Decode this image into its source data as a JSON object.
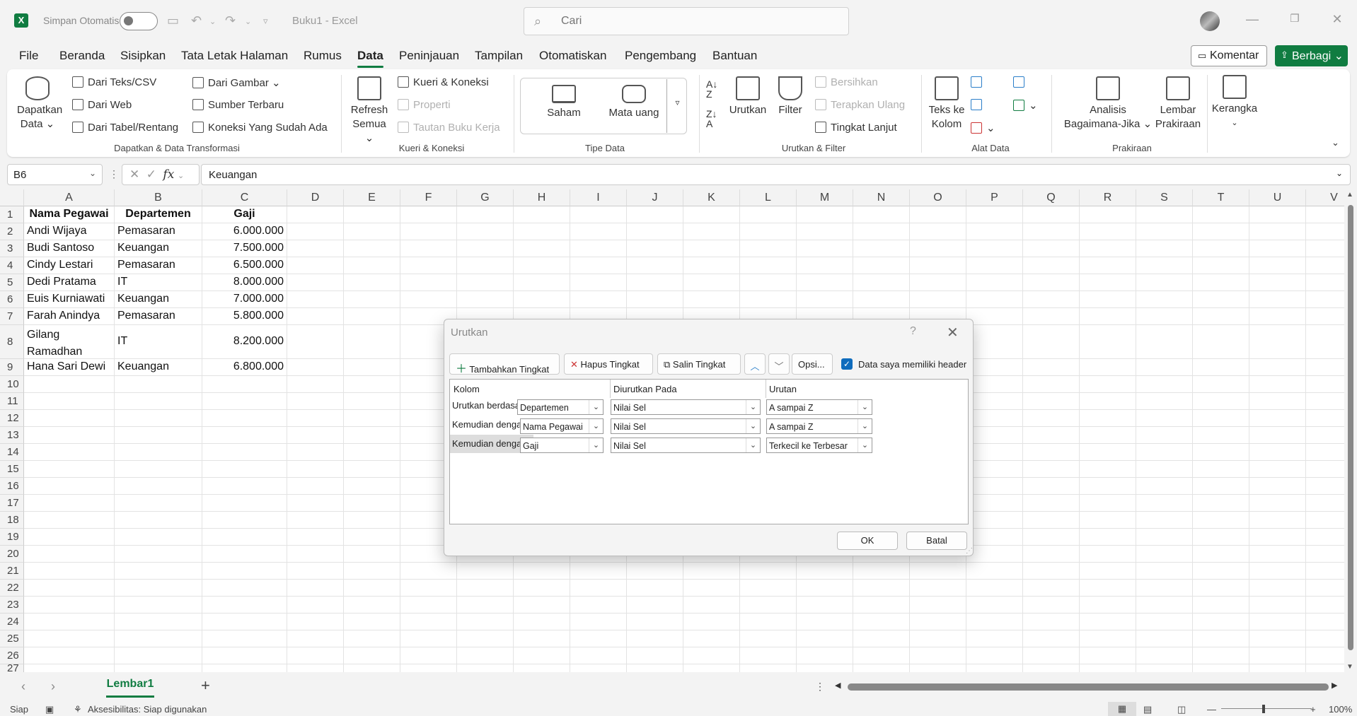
{
  "titlebar": {
    "logo": "X",
    "autosave": "Simpan Otomatis",
    "doc_title": "Buku1  -  Excel",
    "search_placeholder": "Cari"
  },
  "menu": [
    "File",
    "Beranda",
    "Sisipkan",
    "Tata Letak Halaman",
    "Rumus",
    "Data",
    "Peninjauan",
    "Tampilan",
    "Otomatiskan",
    "Pengembang",
    "Bantuan"
  ],
  "actions": {
    "komentar": "Komentar",
    "berbagi": "Berbagi"
  },
  "ribbon": {
    "dapatkan_data": [
      "Dapatkan",
      "Data ⌄"
    ],
    "dari_teks_csv": "Dari Teks/CSV",
    "dari_web": "Dari Web",
    "dari_tabel": "Dari Tabel/Rentang",
    "dari_gambar": "Dari Gambar ⌄",
    "sumber_terbaru": "Sumber Terbaru",
    "koneksi_ada": "Koneksi Yang Sudah Ada",
    "group1": "Dapatkan & Data Transformasi",
    "refresh": [
      "Refresh",
      "Semua ⌄"
    ],
    "kueri_koneksi": "Kueri & Koneksi",
    "properti": "Properti",
    "tautan": "Tautan Buku Kerja",
    "group2": "Kueri & Koneksi",
    "saham": "Saham",
    "mata_uang": "Mata uang",
    "group3": "Tipe Data",
    "urutkan": "Urutkan",
    "filter": "Filter",
    "bersihkan": "Bersihkan",
    "terapkan_ulang": "Terapkan Ulang",
    "tingkat_lanjut": "Tingkat Lanjut",
    "group4": "Urutkan & Filter",
    "teks_ke_kolom": [
      "Teks ke",
      "Kolom"
    ],
    "group5": "Alat Data",
    "analisis": [
      "Analisis",
      "Bagaimana-Jika ⌄"
    ],
    "lembar_prakiraan": [
      "Lembar",
      "Prakiraan"
    ],
    "group6": "Prakiraan",
    "kerangka": "Kerangka"
  },
  "formula_bar": {
    "name_box": "B6",
    "formula": "Keuangan"
  },
  "columns": [
    "A",
    "B",
    "C",
    "D",
    "E",
    "F",
    "G",
    "H",
    "I",
    "J",
    "K",
    "L",
    "M",
    "N",
    "O",
    "P",
    "Q",
    "R",
    "S",
    "T",
    "U",
    "V"
  ],
  "rows": [
    "1",
    "2",
    "3",
    "4",
    "5",
    "6",
    "7",
    "8",
    "9",
    "10",
    "11",
    "12",
    "13",
    "14",
    "15",
    "16",
    "17",
    "18",
    "19",
    "20",
    "21",
    "22",
    "23",
    "24",
    "25",
    "26",
    "27"
  ],
  "sheet": {
    "headers": [
      "Nama Pegawai",
      "Departemen",
      "Gaji"
    ],
    "data": [
      [
        "Andi Wijaya",
        "Pemasaran",
        "6.000.000"
      ],
      [
        "Budi Santoso",
        "Keuangan",
        "7.500.000"
      ],
      [
        "Cindy Lestari",
        "Pemasaran",
        "6.500.000"
      ],
      [
        "Dedi Pratama",
        "IT",
        "8.000.000"
      ],
      [
        "Euis Kurniawati",
        "Keuangan",
        "7.000.000"
      ],
      [
        "Farah Anindya",
        "Pemasaran",
        "5.800.000"
      ],
      [
        "Gilang Ramadhan",
        "IT",
        "8.200.000"
      ],
      [
        "Hana Sari Dewi",
        "Keuangan",
        "6.800.000"
      ]
    ]
  },
  "sheet_tabs": {
    "active": "Lembar1"
  },
  "status": {
    "ready": "Siap",
    "accessibility": "Aksesibilitas: Siap digunakan",
    "zoom": "100%"
  },
  "dialog": {
    "title": "Urutkan",
    "help": "?",
    "buttons": {
      "add_level": "Tambahkan Tingkat",
      "delete_level": "Hapus Tingkat",
      "copy_level": "Salin Tingkat",
      "options": "Opsi...",
      "ok": "OK",
      "cancel": "Batal"
    },
    "header_checkbox": "Data saya memiliki header",
    "columns": [
      "Kolom",
      "Diurutkan Pada",
      "Urutan"
    ],
    "levels": [
      {
        "label": "Urutkan berdasar",
        "column": "Departemen",
        "sort_on": "Nilai Sel",
        "order": "A sampai Z"
      },
      {
        "label": "Kemudian dengan",
        "column": "Nama Pegawai",
        "sort_on": "Nilai Sel",
        "order": "A sampai Z"
      },
      {
        "label": "Kemudian dengan",
        "column": "Gaji",
        "sort_on": "Nilai Sel",
        "order": "Terkecil ke Terbesar"
      }
    ]
  }
}
